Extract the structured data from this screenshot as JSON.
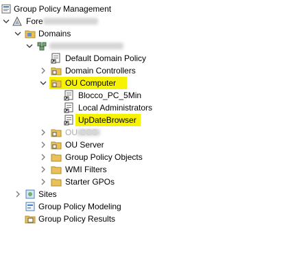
{
  "tree": {
    "root_label": "Group Policy Management",
    "forest_label": "Fore",
    "domains_label": "Domains",
    "domain_label": "",
    "items": {
      "default_domain_policy": "Default Domain Policy",
      "domain_controllers": "Domain Controllers",
      "ou_computer": "OU Computer",
      "blocco_pc": "Blocco_PC_5Min",
      "local_admins": "Local Administrators",
      "update_browser": "UpDateBrowser",
      "ou_obscured": "OU CCC",
      "ou_server": "OU Server",
      "gpo_objects": "Group Policy Objects",
      "wmi_filters": "WMI Filters",
      "starter_gpos": "Starter GPOs"
    },
    "sites_label": "Sites",
    "modeling_label": "Group Policy Modeling",
    "results_label": "Group Policy Results"
  },
  "colors": {
    "highlight": "#f6f200",
    "folder": "#e8c15a",
    "background": "#ffffff"
  }
}
